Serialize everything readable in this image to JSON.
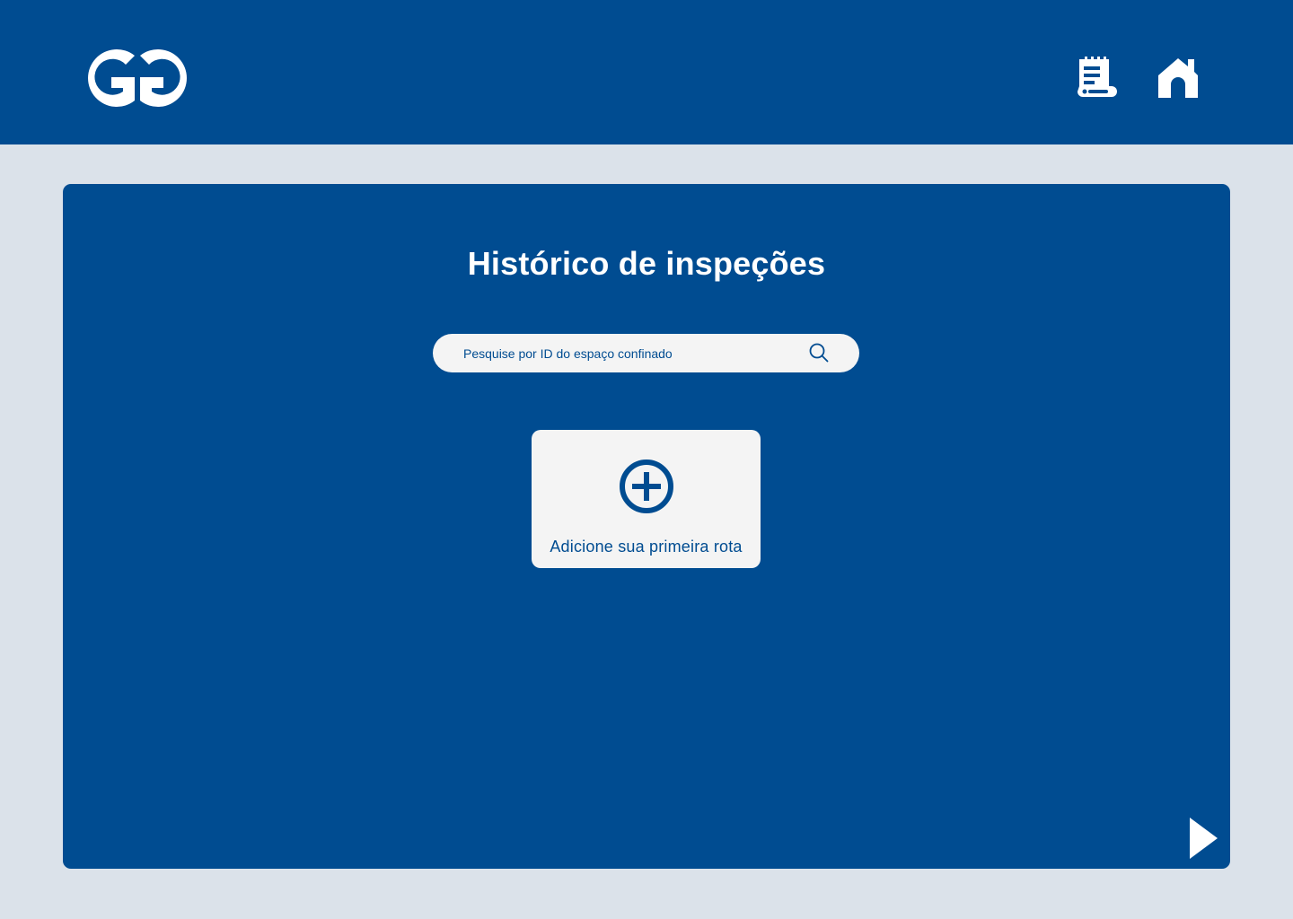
{
  "header": {
    "logo_name": "GG logo",
    "icons": {
      "report": "report-icon",
      "home": "home-icon"
    }
  },
  "main": {
    "title": "Histórico de inspeções",
    "search": {
      "placeholder": "Pesquise por ID do espaço confinado",
      "value": "",
      "icon": "search-icon"
    },
    "add_card": {
      "icon": "plus-circle-icon",
      "label": "Adicione sua primeira rota"
    },
    "next_icon": "play-arrow-icon"
  },
  "colors": {
    "brand_blue": "#004c91",
    "page_background": "#dbe2ea",
    "card_background": "#f4f4f4",
    "white": "#ffffff"
  }
}
